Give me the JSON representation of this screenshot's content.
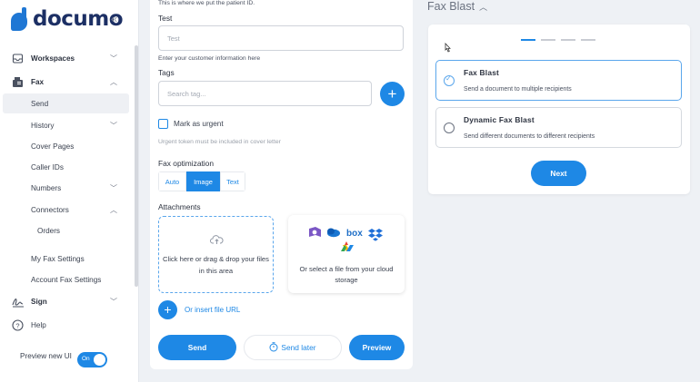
{
  "sidebar": {
    "brand": "documo",
    "items": [
      {
        "label": "Workspaces",
        "icon": "inbox-icon"
      },
      {
        "label": "Fax",
        "icon": "fax-icon"
      },
      {
        "label": "Send"
      },
      {
        "label": "History"
      },
      {
        "label": "Cover Pages"
      },
      {
        "label": "Caller IDs"
      },
      {
        "label": "Numbers"
      },
      {
        "label": "Connectors"
      },
      {
        "label": "Orders"
      },
      {
        "label": "My Fax Settings"
      },
      {
        "label": "Account Fax Settings"
      },
      {
        "label": "Sign",
        "icon": "signature-icon"
      },
      {
        "label": "Help",
        "icon": "help-icon"
      }
    ],
    "preview_label": "Preview new UI",
    "toggle_text": "On"
  },
  "form": {
    "top_hint": "This is where we put the patient ID.",
    "test_label": "Test",
    "test_placeholder": "Test",
    "test_helper": "Enter your customer information here",
    "tags_label": "Tags",
    "tags_placeholder": "Search tag...",
    "urgent_label": "Mark as urgent",
    "urgent_hint": "Urgent token must be included in cover letter",
    "optimization_label": "Fax optimization",
    "optimization_options": [
      "Auto",
      "Image",
      "Text"
    ],
    "optimization_selected": "Image",
    "attachments_label": "Attachments",
    "upload_text": "Click here or drag & drop your files in this area",
    "cloud_text": "Or select a file from your cloud storage",
    "url_link": "Or insert file URL",
    "send_label": "Send",
    "send_later_label": "Send later",
    "preview_label": "Preview"
  },
  "fax_blast": {
    "title": "Fax Blast",
    "steps_total": 4,
    "step_active": 1,
    "options": [
      {
        "title": "Fax Blast",
        "desc": "Send a document to multiple recipients",
        "selected": true
      },
      {
        "title": "Dynamic Fax Blast",
        "desc": "Send different documents to different recipients",
        "selected": false
      }
    ],
    "next_label": "Next"
  },
  "colors": {
    "accent": "#1e88e5",
    "brand_dark": "#1c2f64"
  }
}
